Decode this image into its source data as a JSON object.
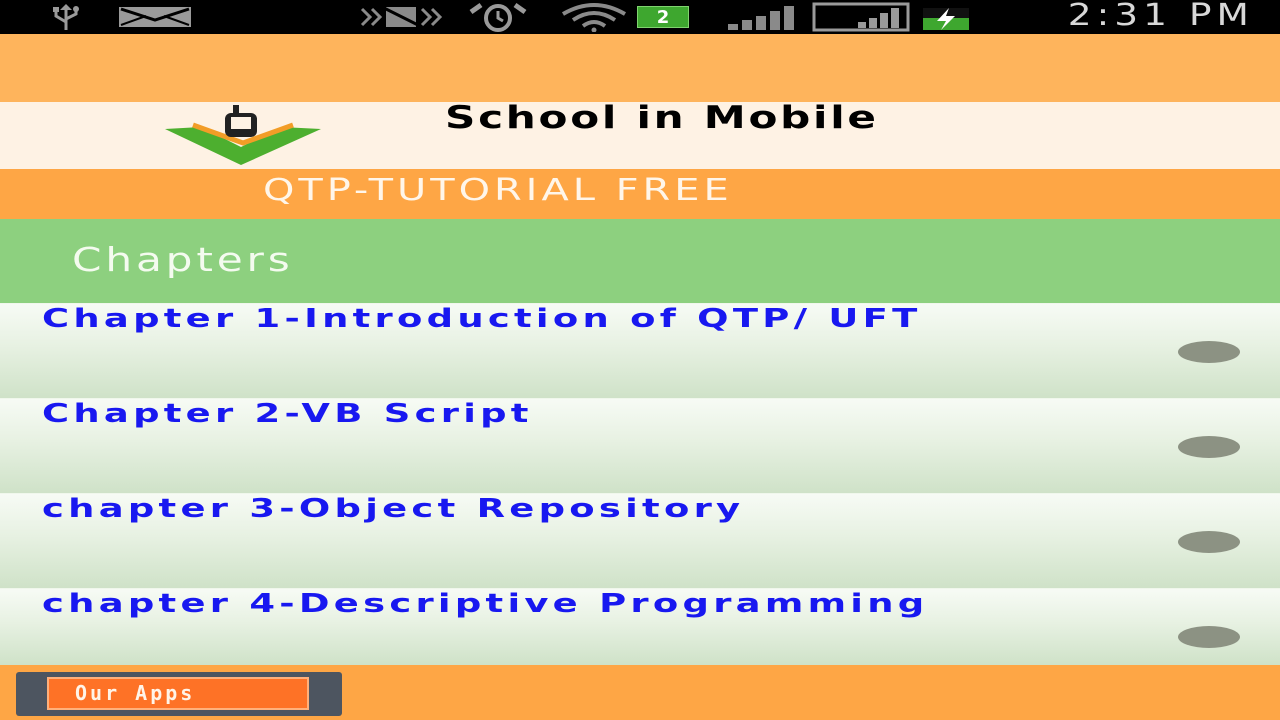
{
  "status_bar": {
    "time": "2:31 PM",
    "notification_count": "2",
    "battery_color": "#3ea72f",
    "icons": [
      "usb-icon",
      "email-icon",
      "vibrate-silent-icon",
      "alarm-icon",
      "wifi-icon",
      "signal-icon",
      "battery-charging-icon"
    ]
  },
  "header": {
    "app_title": "School in Mobile",
    "subtitle": "QTP-TUTORIAL FREE",
    "logo_icon": "mobile-book-logo"
  },
  "section": {
    "title": "Chapters"
  },
  "chapters": [
    {
      "title": "Chapter 1-Introduction of QTP/ UFT"
    },
    {
      "title": "Chapter 2-VB Script"
    },
    {
      "title": "chapter 3-Object Repository"
    },
    {
      "title": "chapter 4-Descriptive Programming"
    }
  ],
  "footer": {
    "apps_button_label": "Our Apps"
  },
  "colors": {
    "orange_light": "#feb45c",
    "orange": "#fea645",
    "green": "#8dd07f",
    "chapter_text": "#1818f0",
    "button": "#fe7226"
  }
}
